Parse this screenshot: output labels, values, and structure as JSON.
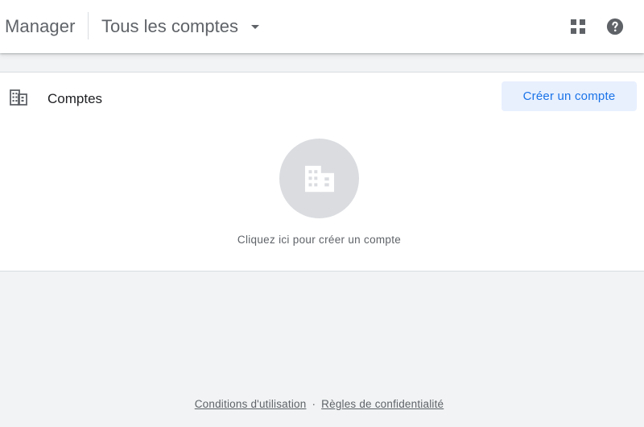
{
  "header": {
    "product_name": "Manager",
    "account_selector": "Tous les comptes",
    "apps_icon": "apps-grid-icon",
    "help_icon": "help-circle-icon"
  },
  "accounts_card": {
    "title": "Comptes",
    "header_icon": "building-icon",
    "create_button_label": "Créer un compte",
    "empty_state_icon": "building-icon",
    "empty_state_text": "Cliquez ici pour créer un compte"
  },
  "footer": {
    "terms_link": "Conditions d'utilisation",
    "separator": "·",
    "privacy_link": "Règles de confidentialité"
  },
  "colors": {
    "accent": "#1a73e8",
    "accent_light": "#e8f0fe",
    "background": "#f1f3f4",
    "icon_grey": "#5f6368",
    "circle_grey": "#dadce0"
  }
}
